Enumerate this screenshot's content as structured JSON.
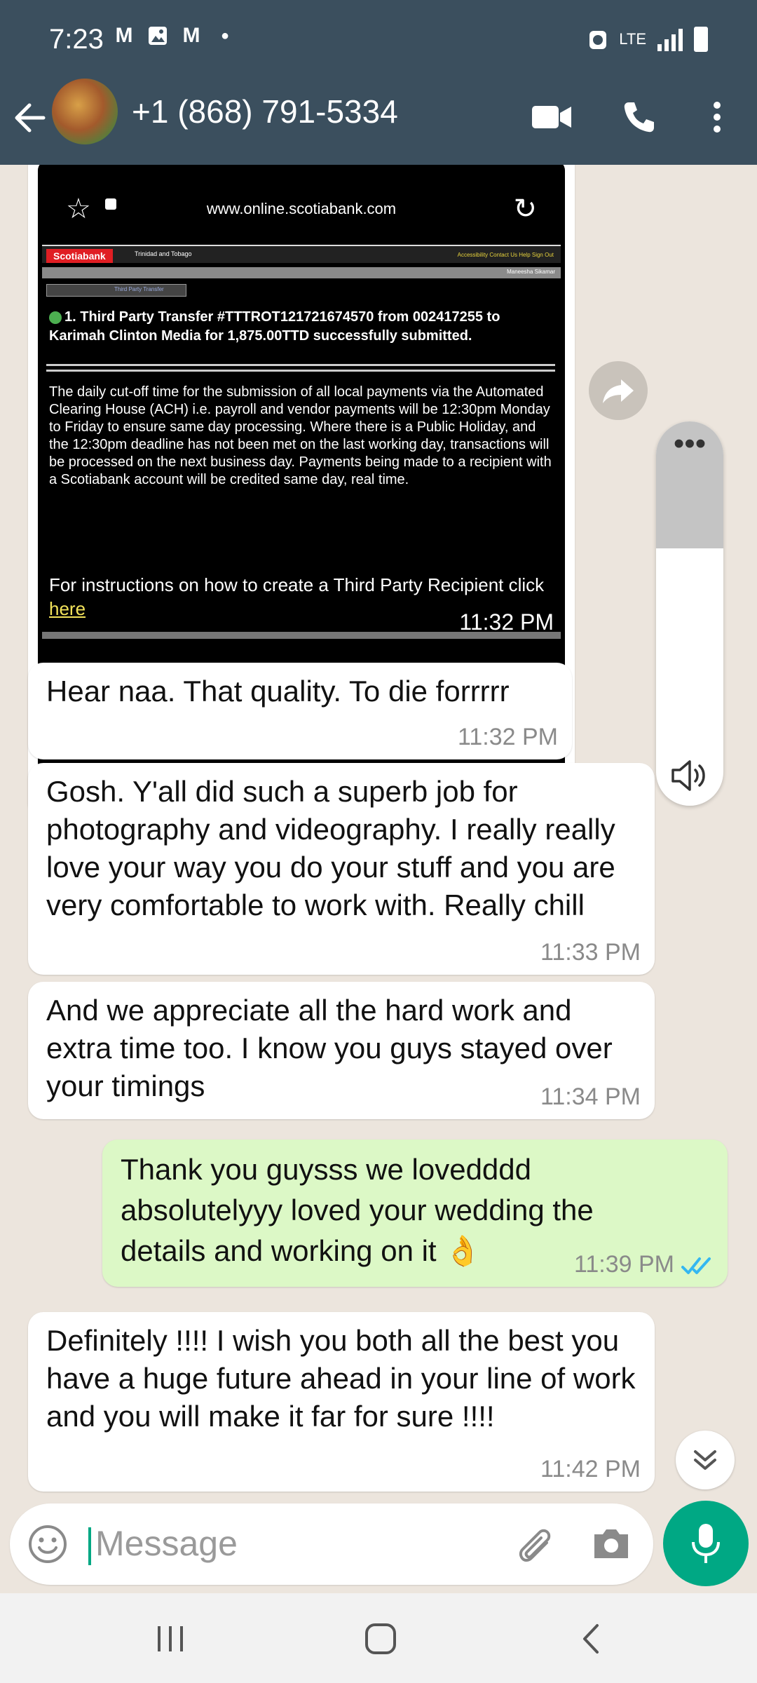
{
  "status_bar": {
    "time": "7:23",
    "notification_icons": [
      "gmail-icon",
      "gallery-icon",
      "gmail-icon"
    ],
    "network": "LTE"
  },
  "header": {
    "contact": "+1 (868) 791-5334",
    "icons": [
      "back-arrow-icon",
      "video-call-icon",
      "voice-call-icon",
      "more-options-icon"
    ]
  },
  "image_message": {
    "url": "www.online.scotiabank.com",
    "bank_name": "Scotiabank",
    "bank_location": "Trinidad and Tobago",
    "bank_links": "Accessibility  Contact Us  Help  Sign Out",
    "user_name": "Maneesha Sikamar",
    "tab_label": "Third Party Transfer",
    "confirmation": "1. Third Party Transfer #TTTROT121721674570 from 002417255 to Karimah Clinton Media for 1,875.00TTD successfully submitted.",
    "body": "The daily cut-off time for the submission of all local payments via the Automated Clearing House (ACH) i.e. payroll and vendor payments will be 12:30pm Monday to Friday to ensure same day processing. Where there is a Public Holiday, and the 12:30pm deadline has not been met on the last working day, transactions will be processed on the next business day. Payments being made to a recipient with a Scotiabank account will be credited same day, real time.",
    "instructions": "For instructions on how to create a Third Party Recipient click",
    "instructions_link": "here",
    "time": "11:32 PM"
  },
  "messages": [
    {
      "text": "Hear naa. That quality. To die forrrrr",
      "time": "11:32 PM",
      "direction": "in"
    },
    {
      "text": "Gosh. Y'all did such a superb job for photography and videography. I really really love your way you do your stuff and you are very comfortable to work with. Really chill",
      "time": "11:33 PM",
      "direction": "in"
    },
    {
      "text": "And we appreciate all the hard work and extra time too. I know you guys stayed over your timings",
      "time": "11:34 PM",
      "direction": "in"
    },
    {
      "text": "Thank you guysss we lovedddd absolutelyyy loved your wedding the details and working on it 👌",
      "time": "11:39 PM",
      "direction": "out",
      "status": "read"
    },
    {
      "text": "Definitely  !!!! I wish you both all the best you have a huge future ahead in your line of work and you will make it far for sure !!!!",
      "time": "11:42 PM",
      "direction": "in"
    }
  ],
  "volume_panel": {
    "level": 0.33
  },
  "input": {
    "placeholder": "Message"
  },
  "colors": {
    "header": "#3b4f5e",
    "chat_background": "#ece5dd",
    "incoming_bubble": "#ffffff",
    "outgoing_bubble": "#dcf8c6",
    "accent": "#00a884",
    "read_ticks": "#34b7f1"
  }
}
